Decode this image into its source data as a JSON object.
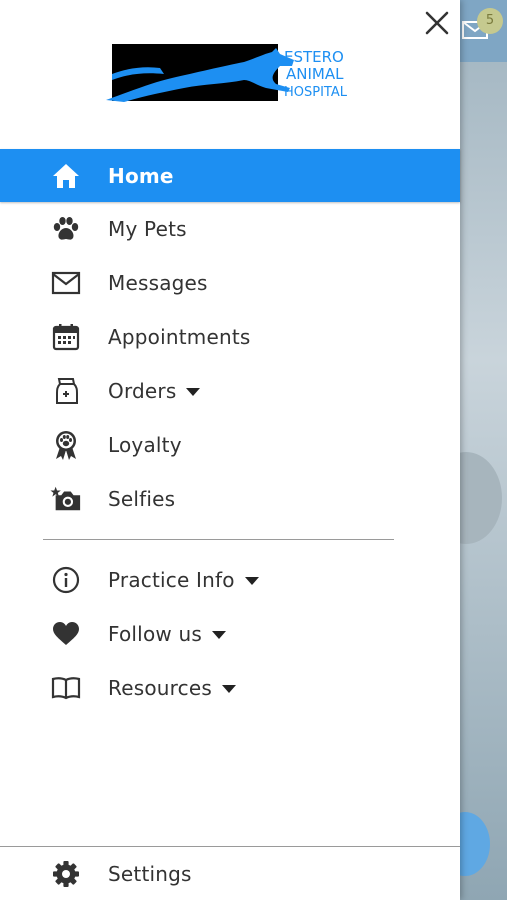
{
  "background": {
    "badge_count": "5"
  },
  "drawer": {
    "logo": {
      "text_line1": "ESTERO",
      "text_line2": "ANIMAL",
      "text_line3": "HOSPITAL",
      "color": "#1d8ff2"
    },
    "menu": [
      {
        "label": "Home",
        "icon": "home-icon",
        "active": true
      },
      {
        "label": "My Pets",
        "icon": "paw-icon"
      },
      {
        "label": "Messages",
        "icon": "envelope-icon"
      },
      {
        "label": "Appointments",
        "icon": "calendar-icon"
      },
      {
        "label": "Orders",
        "icon": "pet-food-bag-icon",
        "has_dropdown": true
      },
      {
        "label": "Loyalty",
        "icon": "paw-ribbon-icon"
      },
      {
        "label": "Selfies",
        "icon": "camera-star-icon"
      }
    ],
    "secondary_menu": [
      {
        "label": "Practice Info",
        "icon": "info-icon",
        "has_dropdown": true
      },
      {
        "label": "Follow us",
        "icon": "heart-icon",
        "has_dropdown": true
      },
      {
        "label": "Resources",
        "icon": "book-icon",
        "has_dropdown": true
      }
    ],
    "settings": {
      "label": "Settings",
      "icon": "gear-icon"
    }
  },
  "colors": {
    "accent": "#1d8ff2",
    "text": "#333333"
  }
}
